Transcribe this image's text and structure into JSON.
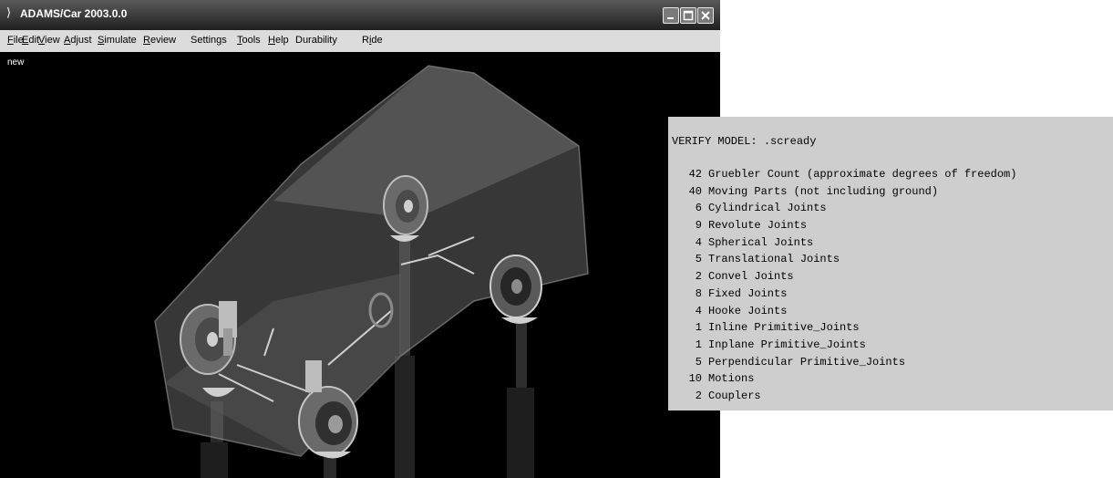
{
  "window": {
    "title": "ADAMS/Car 2003.0.0",
    "controls": [
      "minimize-icon",
      "maximize-icon",
      "close-icon"
    ]
  },
  "menu": [
    {
      "label": "File",
      "u": "F",
      "rest": "ile"
    },
    {
      "label": "Edit",
      "u": "E",
      "rest": "dit"
    },
    {
      "label": "View",
      "u": "V",
      "rest": "iew"
    },
    {
      "label": "Adjust",
      "u": "A",
      "rest": "djust"
    },
    {
      "label": "Simulate",
      "u": "S",
      "rest": "imulate"
    },
    {
      "label": "Review",
      "u": "R",
      "rest": "eview"
    },
    {
      "label": "Settings",
      "pre": "Settin",
      "u": "g",
      "rest": "s"
    },
    {
      "label": "Tools",
      "u": "T",
      "rest": "ools"
    },
    {
      "label": "Help",
      "u": "H",
      "rest": "elp"
    },
    {
      "label": "Durability",
      "pre": "Durability",
      "u": "",
      "rest": ""
    },
    {
      "label": "Ride",
      "pre": "R",
      "u": "i",
      "rest": "de"
    }
  ],
  "viewport": {
    "label": "new"
  },
  "verify": {
    "title": "VERIFY MODEL: .scready",
    "rows": [
      {
        "count": "42",
        "label": "Gruebler Count (approximate degrees of freedom)"
      },
      {
        "count": "40",
        "label": "Moving Parts (not including ground)"
      },
      {
        "count": "6",
        "label": "Cylindrical Joints"
      },
      {
        "count": "9",
        "label": "Revolute Joints"
      },
      {
        "count": "4",
        "label": "Spherical Joints"
      },
      {
        "count": "5",
        "label": "Translational Joints"
      },
      {
        "count": "2",
        "label": "Convel Joints"
      },
      {
        "count": "8",
        "label": "Fixed Joints"
      },
      {
        "count": "4",
        "label": "Hooke Joints"
      },
      {
        "count": "1",
        "label": "Inline Primitive_Joints"
      },
      {
        "count": "1",
        "label": "Inplane Primitive_Joints"
      },
      {
        "count": "5",
        "label": "Perpendicular Primitive_Joints"
      },
      {
        "count": "10",
        "label": "Motions"
      },
      {
        "count": "2",
        "label": "Couplers"
      }
    ]
  }
}
